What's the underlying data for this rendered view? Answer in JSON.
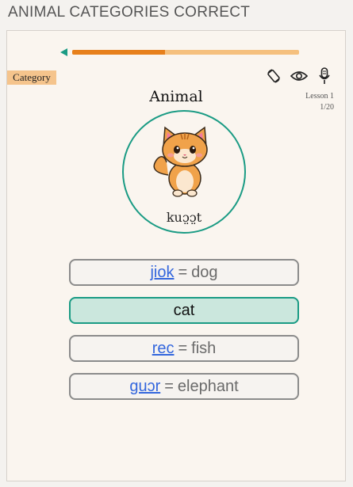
{
  "header": {
    "title": "ANIMAL CATEGORIES CORRECT"
  },
  "progress": {
    "fraction": 0.41
  },
  "category": {
    "label": "Category"
  },
  "icons": [
    "rotate-icon",
    "eye-icon",
    "microphone-icon",
    "back-arrow-icon",
    "cat-image"
  ],
  "lesson": {
    "name": "Lesson 1",
    "count": "1/20"
  },
  "word": {
    "title": "Animal",
    "pronunciation": "kuɔ̤ɔ̤t"
  },
  "options": [
    {
      "word": "jiok",
      "sep": "=",
      "meaning": "dog",
      "selected": false
    },
    {
      "word": "",
      "sep": "",
      "meaning": "cat",
      "selected": true
    },
    {
      "word": "rec",
      "sep": "=",
      "meaning": "fish",
      "selected": false
    },
    {
      "word": "guɔr",
      "sep": "=",
      "meaning": "elephant",
      "selected": false
    }
  ],
  "colors": {
    "accent": "#1a9b84",
    "progress_fill": "#e7801c",
    "progress_track": "#f5c07e",
    "link": "#3366dd"
  }
}
